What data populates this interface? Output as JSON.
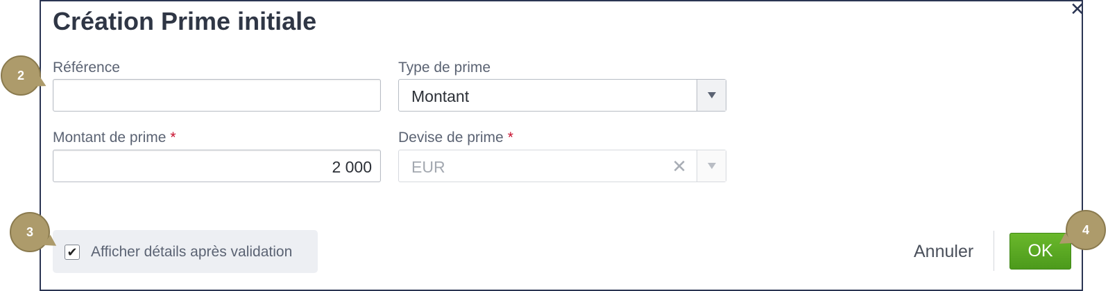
{
  "dialog": {
    "title": "Création Prime initiale",
    "close_icon": "close-icon"
  },
  "form": {
    "reference": {
      "label": "Référence",
      "value": ""
    },
    "type_prime": {
      "label": "Type de prime",
      "value": "Montant"
    },
    "montant": {
      "label": "Montant de prime",
      "required_mark": "*",
      "value": "2 000"
    },
    "devise": {
      "label": "Devise de prime",
      "required_mark": "*",
      "value": "EUR",
      "disabled": true
    }
  },
  "footer": {
    "checkbox_label": "Afficher détails après validation",
    "checkbox_checked": true,
    "checkbox_glyph": "✔",
    "cancel_label": "Annuler",
    "ok_label": "OK"
  },
  "callouts": [
    "2",
    "3",
    "4"
  ],
  "colors": {
    "title": "#2f3645",
    "required": "#c8102e",
    "ok_button": "#5aa823",
    "callout": "#ad9b6b",
    "dialog_border": "#2a3452"
  }
}
